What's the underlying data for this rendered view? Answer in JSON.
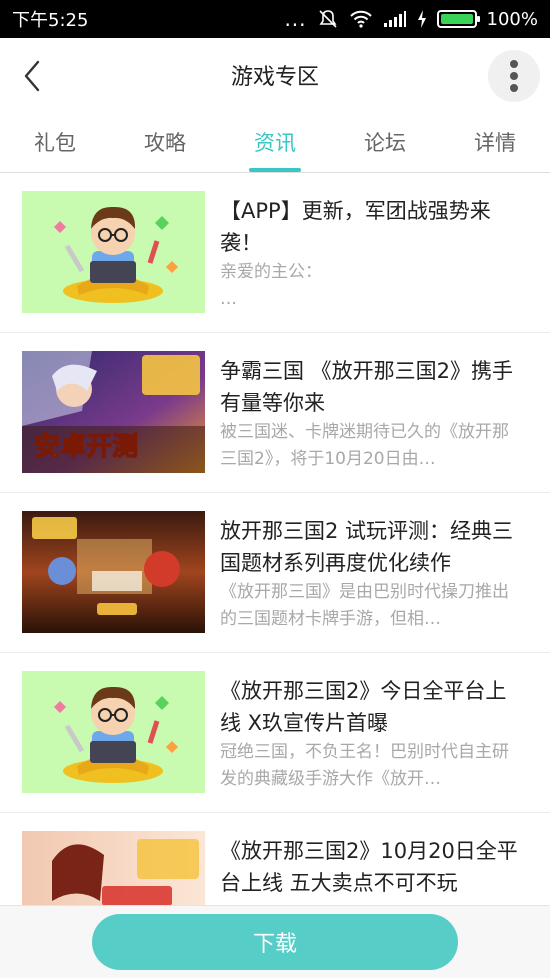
{
  "status_bar": {
    "time": "下午5:25",
    "dots": "...",
    "battery_level": 1.0,
    "battery_text": "100%"
  },
  "header": {
    "title": "游戏专区"
  },
  "tabs": [
    {
      "label": "礼包",
      "active": false
    },
    {
      "label": "攻略",
      "active": false
    },
    {
      "label": "资讯",
      "active": true
    },
    {
      "label": "论坛",
      "active": false
    },
    {
      "label": "详情",
      "active": false
    }
  ],
  "news": [
    {
      "title": "【APP】更新，军团战强势来袭！",
      "summary": "亲爱的主公：\n…",
      "thumb": "cartoon-boy-laptop"
    },
    {
      "title": "争霸三国 《放开那三国2》携手有量等你来",
      "summary": "被三国迷、卡牌迷期待已久的《放开那三国2》，将于10月20日由…",
      "thumb": "game-promo-android-test",
      "thumb_text": "安卓开测"
    },
    {
      "title": "放开那三国2 试玩评测：经典三国题材系列再度优化续作",
      "summary": "《放开那三国》是由巴别时代操刀推出的三国题材卡牌手游，但相…",
      "thumb": "game-screenshot-battle"
    },
    {
      "title": "《放开那三国2》今日全平台上线 X玖宣传片首曝",
      "summary": "冠绝三国，不负王名！巴别时代自主研发的典藏级手游大作《放开…",
      "thumb": "cartoon-boy-laptop"
    },
    {
      "title": "《放开那三国2》10月20日全平台上线 五大卖点不可不玩",
      "summary": "",
      "thumb": "game-promo-heroine"
    }
  ],
  "bottom": {
    "download_label": "下载"
  },
  "colors": {
    "accent": "#39c6c4",
    "download": "#56cdc7",
    "thumb_bg_green": "#c8fab0"
  }
}
